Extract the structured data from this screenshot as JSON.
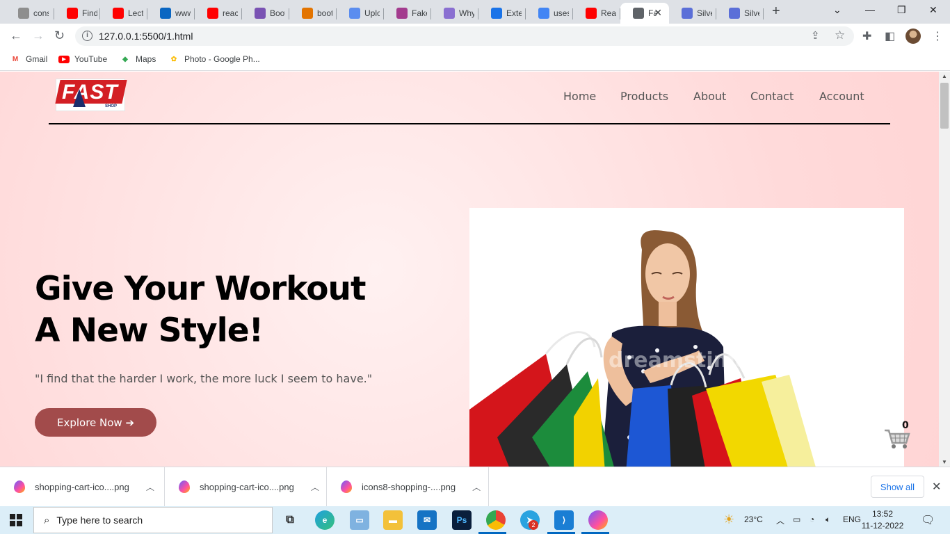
{
  "browser": {
    "tabs": [
      {
        "title": "console",
        "icon": "tab-page-icon",
        "color": "#8e8e8e"
      },
      {
        "title": "Find",
        "icon": "youtube-icon",
        "color": "#ff0000"
      },
      {
        "title": "Lecture",
        "icon": "youtube-icon",
        "color": "#ff0000"
      },
      {
        "title": "www",
        "icon": "linkedin-icon",
        "color": "#0a66c2"
      },
      {
        "title": "react",
        "icon": "youtube-icon",
        "color": "#ff0000"
      },
      {
        "title": "Bootstrap",
        "icon": "bootstrap-icon",
        "color": "#7952b3"
      },
      {
        "title": "bootstrap",
        "icon": "code-icon",
        "color": "#e37400"
      },
      {
        "title": "Upload",
        "icon": "flag-icon",
        "color": "#5b8def"
      },
      {
        "title": "Fake",
        "icon": "fakestore-icon",
        "color": "#a33b8e"
      },
      {
        "title": "Why",
        "icon": "graph-icon",
        "color": "#8a6fd1"
      },
      {
        "title": "Extension",
        "icon": "puzzle-icon",
        "color": "#1a73e8"
      },
      {
        "title": "usese",
        "icon": "google-icon",
        "color": "#4285f4"
      },
      {
        "title": "React",
        "icon": "youtube-icon",
        "color": "#ff0000"
      },
      {
        "title": "Fa",
        "icon": "globe-icon",
        "color": "#5f6368",
        "active": true
      },
      {
        "title": "Silver",
        "icon": "silver-icon",
        "color": "#5b6fd8"
      },
      {
        "title": "Silver",
        "icon": "silver-icon",
        "color": "#5b6fd8"
      }
    ],
    "url": "127.0.0.1:5500/1.html",
    "bookmarks": [
      {
        "label": "Gmail",
        "icon": "gmail-icon",
        "color": "#ea4335"
      },
      {
        "label": "YouTube",
        "icon": "youtube-icon",
        "color": "#ff0000"
      },
      {
        "label": "Maps",
        "icon": "maps-icon",
        "color": "#34a853"
      },
      {
        "label": "Photo - Google Ph...",
        "icon": "google-photos-icon",
        "color": "#fbbc04"
      }
    ]
  },
  "site": {
    "logo_text": "FAST",
    "logo_sub": "SHOP",
    "nav": [
      "Home",
      "Products",
      "About",
      "Contact",
      "Account"
    ],
    "hero": {
      "title_line1": "Give Your Workout",
      "title_line2": "A New Style!",
      "quote": "\"I find that the harder I work, the more luck I seem to have.\"",
      "cta": "Explore Now ➔"
    },
    "cart_count": "0",
    "watermark": "dreamstime."
  },
  "downloads": {
    "items": [
      "shopping-cart-ico....png",
      "shopping-cart-ico....png",
      "icons8-shopping-....png"
    ],
    "show_all": "Show all"
  },
  "taskbar": {
    "search_placeholder": "Type here to search",
    "weather": "23°C",
    "lang": "ENG",
    "time": "13:52",
    "date": "11-12-2022",
    "telegram_badge": "2"
  }
}
